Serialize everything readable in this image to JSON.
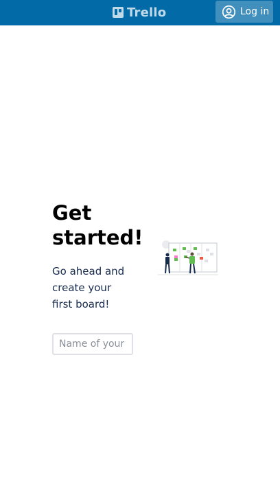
{
  "header": {
    "brand": "Trello",
    "login_label": "Log in",
    "background_color": "#026aa7"
  },
  "main": {
    "title": "Get started!",
    "subtitle": "Go ahead and create your first board!",
    "board_name_placeholder": "Name of your board",
    "board_name_value": ""
  },
  "icons": {
    "brand": "trello-logo-icon",
    "login": "user-circle-icon",
    "illustration": "people-at-kanban-board-illustration"
  }
}
